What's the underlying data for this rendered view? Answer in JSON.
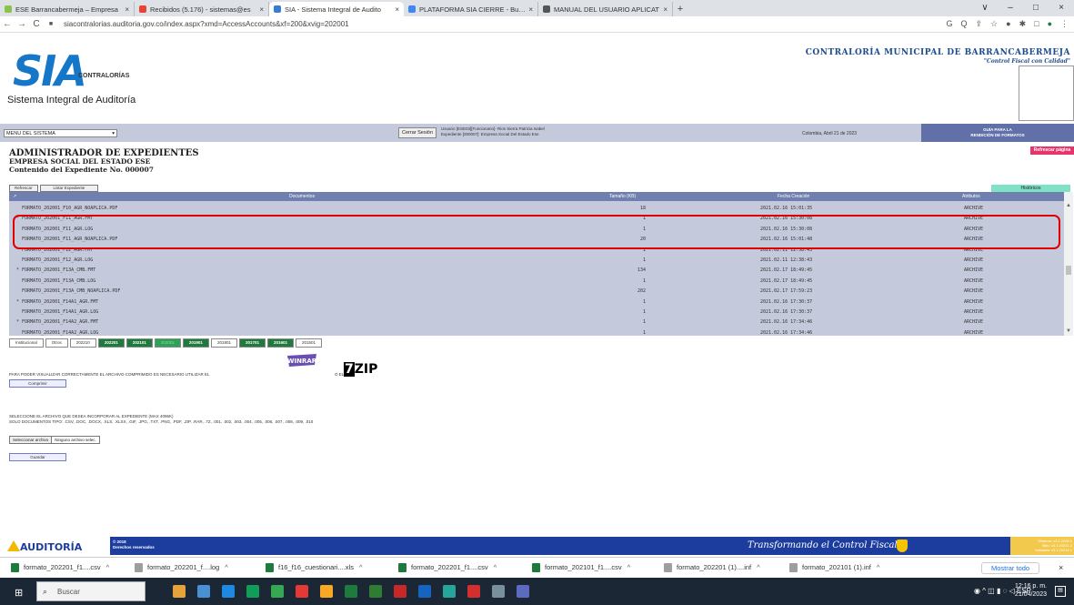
{
  "browser": {
    "tabs": [
      {
        "label": "ESE Barrancabermeja – Empresa",
        "color": "#8bc34a",
        "active": false
      },
      {
        "label": "Recibidos (5.176) - sistemas@es",
        "color": "#ea4335",
        "active": false
      },
      {
        "label": "SIA - Sistema Integral de Audito",
        "color": "#3a7bd5",
        "active": true
      },
      {
        "label": "PLATAFORMA SIA CIERRE - Busca",
        "color": "#4285f4",
        "active": false
      },
      {
        "label": "MANUAL DEL USUARIO APLICAT",
        "color": "#555555",
        "active": false
      }
    ],
    "new_tab": "+",
    "url": "siacontralorias.auditoria.gov.co/index.aspx?xmd=AccessAccounts&xf=200&xvig=202001",
    "controls": [
      "∨",
      "–",
      "□",
      "×"
    ]
  },
  "header": {
    "logo_sia": "SIA",
    "logo_contralorias": "CONTRALORÍAS",
    "logo_subtitle": "Sistema Integral de Auditoría",
    "entity_name": "CONTRALORÍA MUNICIPAL DE BARRANCABERMEJA",
    "slogan": "\"Control Fiscal con Calidad\""
  },
  "toolbar": {
    "menu_label": "MENU DEL SISTEMA",
    "close_session": "Cerrar Sesión",
    "user_line1": "Usuario [ESE03][Funcionario]- Rios Sierra Patricia Isabel",
    "user_line2": "Expediente [000007]: Empresa Social Del Estado Ese",
    "date": "Colombia, Abril 21 de 2023",
    "guide_line1": "GUÍA PARA LA",
    "guide_line2": "RENDICIÓN DE FORMATOS"
  },
  "admin": {
    "title": "ADMINISTRADOR DE EXPEDIENTES",
    "company": "EMPRESA SOCIAL DEL ESTADO ESE",
    "content": "Contenido del Expediente No. 000007",
    "refresh_page": "Refrescar página",
    "refresh_btn": "Refrescar",
    "list_btn": "Listar Expediente",
    "historic": "Históricos"
  },
  "grid": {
    "headers": {
      "documents": "Documentos",
      "size": "Tamaño (KB)",
      "date": "Fecha Creación",
      "attrs": "Atributos"
    },
    "rows": [
      {
        "name": "FORMATO_202001_F10_AGR_NOAPLICA.PDF",
        "size": "18",
        "date": "2021.02.16 15:01:35",
        "attr": "ARCHIVE",
        "mark": ""
      },
      {
        "name": "FORMATO_202001_F11_AGR.FMT",
        "size": "1",
        "date": "2021.02.16 15:30:08",
        "attr": "ARCHIVE",
        "mark": "*"
      },
      {
        "name": "FORMATO_202001_F11_AGR.LOG",
        "size": "1",
        "date": "2021.02.16 15:30:08",
        "attr": "ARCHIVE",
        "mark": ""
      },
      {
        "name": "FORMATO_202001_F11_AGR_NOAPLICA.PDF",
        "size": "20",
        "date": "2021.02.16 15:01:48",
        "attr": "ARCHIVE",
        "mark": ""
      },
      {
        "name": "FORMATO_202001_F12_AGR.FMT",
        "size": "1",
        "date": "2021.02.11 12:38:43",
        "attr": "ARCHIVE",
        "mark": ""
      },
      {
        "name": "FORMATO_202001_F12_AGR.LOG",
        "size": "1",
        "date": "2021.02.11 12:38:43",
        "attr": "ARCHIVE",
        "mark": ""
      },
      {
        "name": "FORMATO_202001_F13A_CMB.FMT",
        "size": "134",
        "date": "2021.02.17 18:49:45",
        "attr": "ARCHIVE",
        "mark": "*"
      },
      {
        "name": "FORMATO_202001_F13A_CMB.LOG",
        "size": "1",
        "date": "2021.02.17 18:49:45",
        "attr": "ARCHIVE",
        "mark": ""
      },
      {
        "name": "FORMATO_202001_F13A_CMB_NOAPLICA.PDF",
        "size": "202",
        "date": "2021.02.17 17:59:23",
        "attr": "ARCHIVE",
        "mark": ""
      },
      {
        "name": "FORMATO_202001_F14A1_AGR.FMT",
        "size": "1",
        "date": "2021.02.16 17:30:37",
        "attr": "ARCHIVE",
        "mark": "*"
      },
      {
        "name": "FORMATO_202001_F14A1_AGR.LOG",
        "size": "1",
        "date": "2021.02.16 17:30:37",
        "attr": "ARCHIVE",
        "mark": ""
      },
      {
        "name": "FORMATO_202001_F14A2_AGR.FMT",
        "size": "1",
        "date": "2021.02.16 17:34:46",
        "attr": "ARCHIVE",
        "mark": "*"
      },
      {
        "name": "FORMATO_202001_F14A2_AGR.LOG",
        "size": "1",
        "date": "2021.02.16 17:34:46",
        "attr": "ARCHIVE",
        "mark": ""
      }
    ]
  },
  "years": [
    {
      "label": "Institucional",
      "style": "w"
    },
    {
      "label": "Otros",
      "style": "w"
    },
    {
      "label": "202210",
      "style": "w"
    },
    {
      "label": "202201",
      "style": "g"
    },
    {
      "label": "202101",
      "style": "g"
    },
    {
      "label": "202001",
      "style": "lg"
    },
    {
      "label": "201901",
      "style": "g"
    },
    {
      "label": "201801",
      "style": "w"
    },
    {
      "label": "201701",
      "style": "g"
    },
    {
      "label": "201601",
      "style": "g"
    },
    {
      "label": "201501",
      "style": "w"
    }
  ],
  "upload": {
    "notice": "PARA PODER VISUALIZAR CORRECTAMENTE EL ARCHIVO COMPRIMIDO ES NECESARIO UTILIZAR EL",
    "winrar": "WINRAR",
    "or_the": "O EL",
    "zip_label": "ZIP",
    "zip_seven": "7",
    "compress": "Comprimir",
    "select_line1": "SELECCIONE EL ARCHIVO QUE DESEA INCORPORAR AL EXPEDIENTE (MAX 4096K)",
    "select_line2": "SOLO DOCUMENTOS TIPO: .CSV, .DOC, .DOCX, .XLS, .XLSX, .GIF, .JPG, .TXT, .PNG, .PDF, .ZIP, .RAR, .7Z, .001, .002, .003, .004, .005, .006, .007, .008, .009, .010",
    "file_button": "Seleccionar archivo",
    "file_status": "Ninguno archivo selec.",
    "save": "Guardar"
  },
  "footer": {
    "logo": "AUDITORÍA",
    "copyright_year": "© 2018",
    "copyright_text": "Derechos reservados",
    "slogan": "Transformando el Control Fiscal",
    "version_1": "Sistema: v3.1.2206.1",
    "version_2": "Sitio: v3.1.20221.2",
    "version_3": "Validador v3.1.20214.1"
  },
  "downloads": {
    "items": [
      {
        "label": "formato_202201_f1....csv",
        "color": "#1e7b3e"
      },
      {
        "label": "formato_202201_f....log",
        "color": "#9e9e9e"
      },
      {
        "label": "f16_f16_cuestionari....xls",
        "color": "#1e7b3e"
      },
      {
        "label": "formato_202201_f1....csv",
        "color": "#1e7b3e"
      },
      {
        "label": "formato_202101_f1....csv",
        "color": "#1e7b3e"
      },
      {
        "label": "formato_202201 (1)....inf",
        "color": "#9e9e9e"
      },
      {
        "label": "formato_202101 (1).inf",
        "color": "#9e9e9e"
      }
    ],
    "chevron": "^",
    "show_all": "Mostrar todo",
    "close": "×"
  },
  "taskbar": {
    "search": "Buscar",
    "time": "12:16 p. m.",
    "date": "21/04/2023",
    "lang": "ESP",
    "icon_colors": [
      "#e8a23a",
      "#4a8fd6",
      "#1e88e5",
      "#0f9d58",
      "#34a853",
      "#e53935",
      "#f9a825",
      "#1e7b3e",
      "#2e7d32",
      "#c62828",
      "#1565c0",
      "#26a69a",
      "#d32f2f",
      "#78909c",
      "#5c6bc0"
    ]
  }
}
